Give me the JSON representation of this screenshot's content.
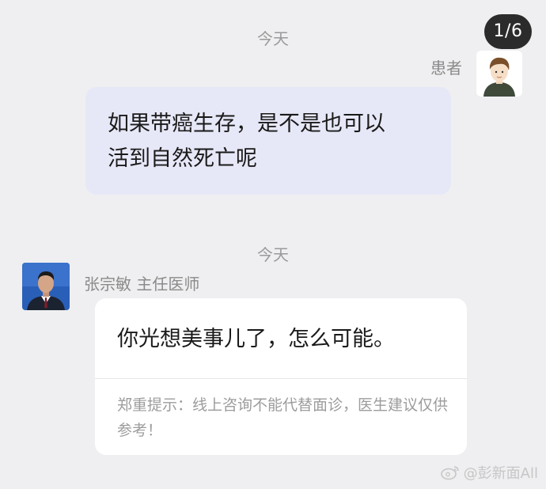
{
  "page_counter": "1/6",
  "messages": {
    "first_timestamp": "今天",
    "patient": {
      "name": "患者",
      "text_line1": "如果带癌生存，是不是也可以",
      "text_line2": "活到自然死亡呢"
    },
    "second_timestamp": "今天",
    "doctor": {
      "name": "张宗敏 主任医师",
      "reply": "你光想美事儿了，怎么可能。",
      "notice": "郑重提示：线上咨询不能代替面诊，医生建议仅供参考！"
    }
  },
  "watermark": {
    "text": "@彭新面All",
    "icon": "weibo-icon"
  },
  "colors": {
    "background": "#efeff1",
    "patient_bubble": "#e7e8f7",
    "doctor_card": "#ffffff",
    "muted_text": "#8a8a8a"
  }
}
